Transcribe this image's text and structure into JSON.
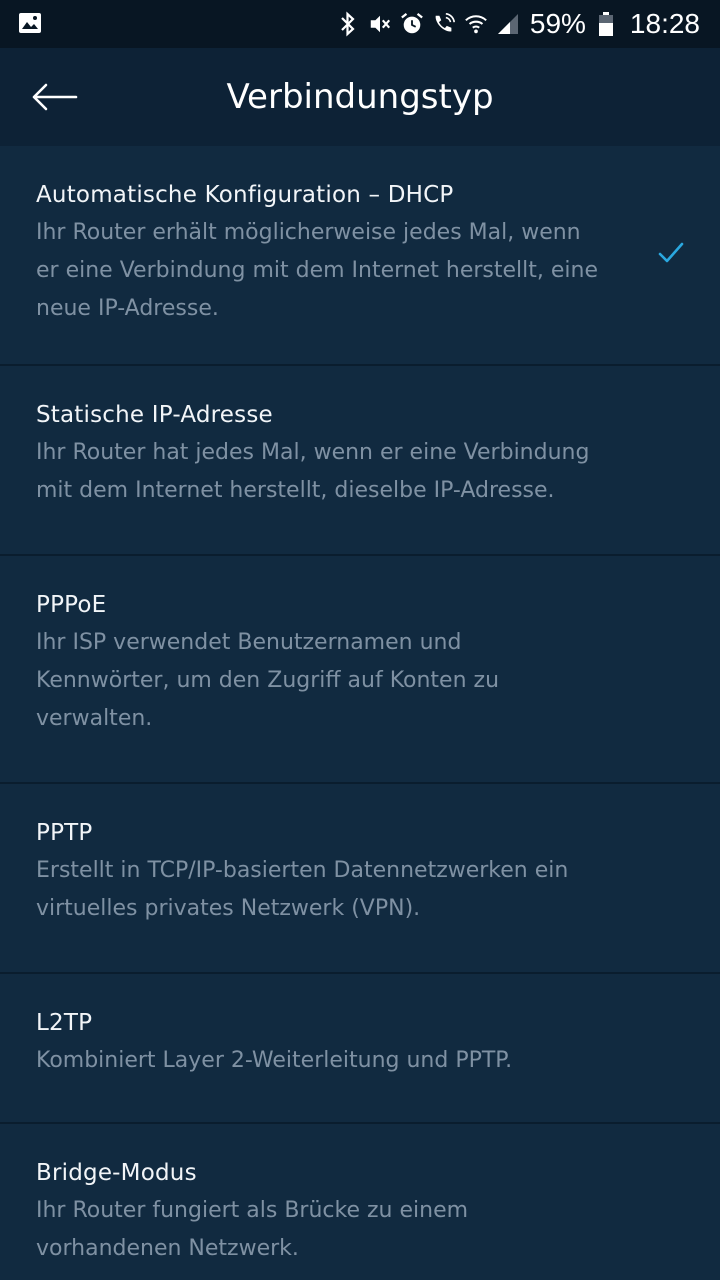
{
  "status_bar": {
    "battery": "59%",
    "time": "18:28"
  },
  "header": {
    "title": "Verbindungstyp"
  },
  "options": [
    {
      "title": "Automatische Konfiguration – DHCP",
      "description": "Ihr Router erhält möglicherweise jedes Mal, wenn er eine Verbindung mit dem Internet herstellt, eine neue IP-Adresse.",
      "selected": true
    },
    {
      "title": "Statische IP-Adresse",
      "description": "Ihr Router hat jedes Mal, wenn er eine Verbindung mit dem Internet herstellt, dieselbe IP-Adresse.",
      "selected": false
    },
    {
      "title": "PPPoE",
      "description": "Ihr ISP verwendet Benutzernamen und Kennwörter, um den Zugriff auf Konten zu verwalten.",
      "selected": false
    },
    {
      "title": "PPTP",
      "description": "Erstellt in TCP/IP-basierten Datennetzwerken ein virtuelles privates Netzwerk (VPN).",
      "selected": false
    },
    {
      "title": "L2TP",
      "description": "Kombiniert Layer 2-Weiterleitung und PPTP.",
      "selected": false
    },
    {
      "title": "Bridge-Modus",
      "description": "Ihr Router fungiert als Brücke zu einem vorhandenen Netzwerk.",
      "selected": false
    }
  ],
  "colors": {
    "background": "#112a40",
    "header_background": "#0d2236",
    "status_bar": "#081623",
    "accent_check": "#2aa8e0",
    "description_text": "#7f91a3"
  },
  "icons": {
    "status_left": "image-icon",
    "status_right": [
      "bluetooth-icon",
      "mute-icon",
      "alarm-icon",
      "wifi-calling-icon",
      "wifi-icon",
      "signal-icon",
      "battery-icon"
    ],
    "back": "back-arrow-icon",
    "selected": "check-icon"
  }
}
